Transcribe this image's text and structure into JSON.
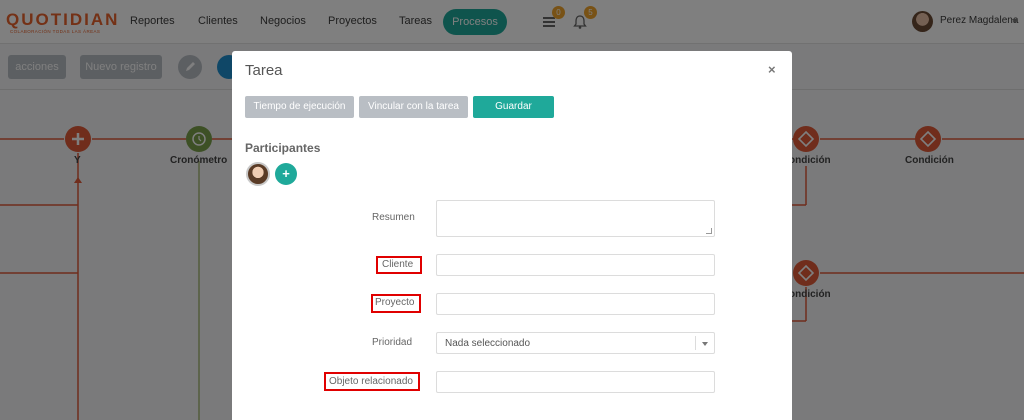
{
  "brand": {
    "logo": "QUOTIDIAN",
    "tagline": "COLABORACIÓN TODAS LAS ÁREAS"
  },
  "nav": {
    "items": [
      "Reportes",
      "Clientes",
      "Negocios",
      "Proyectos",
      "Tareas"
    ],
    "active": "Procesos"
  },
  "topbar": {
    "list_badge": "0",
    "bell_badge": "5",
    "user_name": "Perez Magdalena"
  },
  "toolbar": {
    "actions_label": "acciones",
    "new_record_label": "Nuevo registro"
  },
  "diagram": {
    "nodes": [
      {
        "label": "Y"
      },
      {
        "label": "Cronómetro"
      },
      {
        "label": "ondición"
      },
      {
        "label": "Condición"
      },
      {
        "label": "ondición"
      }
    ],
    "colors": {
      "gateway": "#e05a38",
      "timer": "#7aa04a",
      "line": "#e05a38"
    }
  },
  "modal": {
    "title": "Tarea",
    "close": "×",
    "buttons": {
      "execution_time": "Tiempo de ejecución",
      "link_task": "Vincular con la tarea",
      "save": "Guardar"
    },
    "participants_title": "Participantes",
    "add_participant": "+",
    "fields": {
      "summary_label": "Resumen",
      "summary_value": "",
      "client_label": "Cliente",
      "client_value": "",
      "project_label": "Proyecto",
      "project_value": "",
      "priority_label": "Prioridad",
      "priority_value": "Nada seleccionado",
      "related_label": "Objeto relacionado",
      "related_value": ""
    }
  },
  "colors": {
    "accent": "#1fa99a",
    "badge": "#f0a52c",
    "highlight": "#e00000"
  }
}
